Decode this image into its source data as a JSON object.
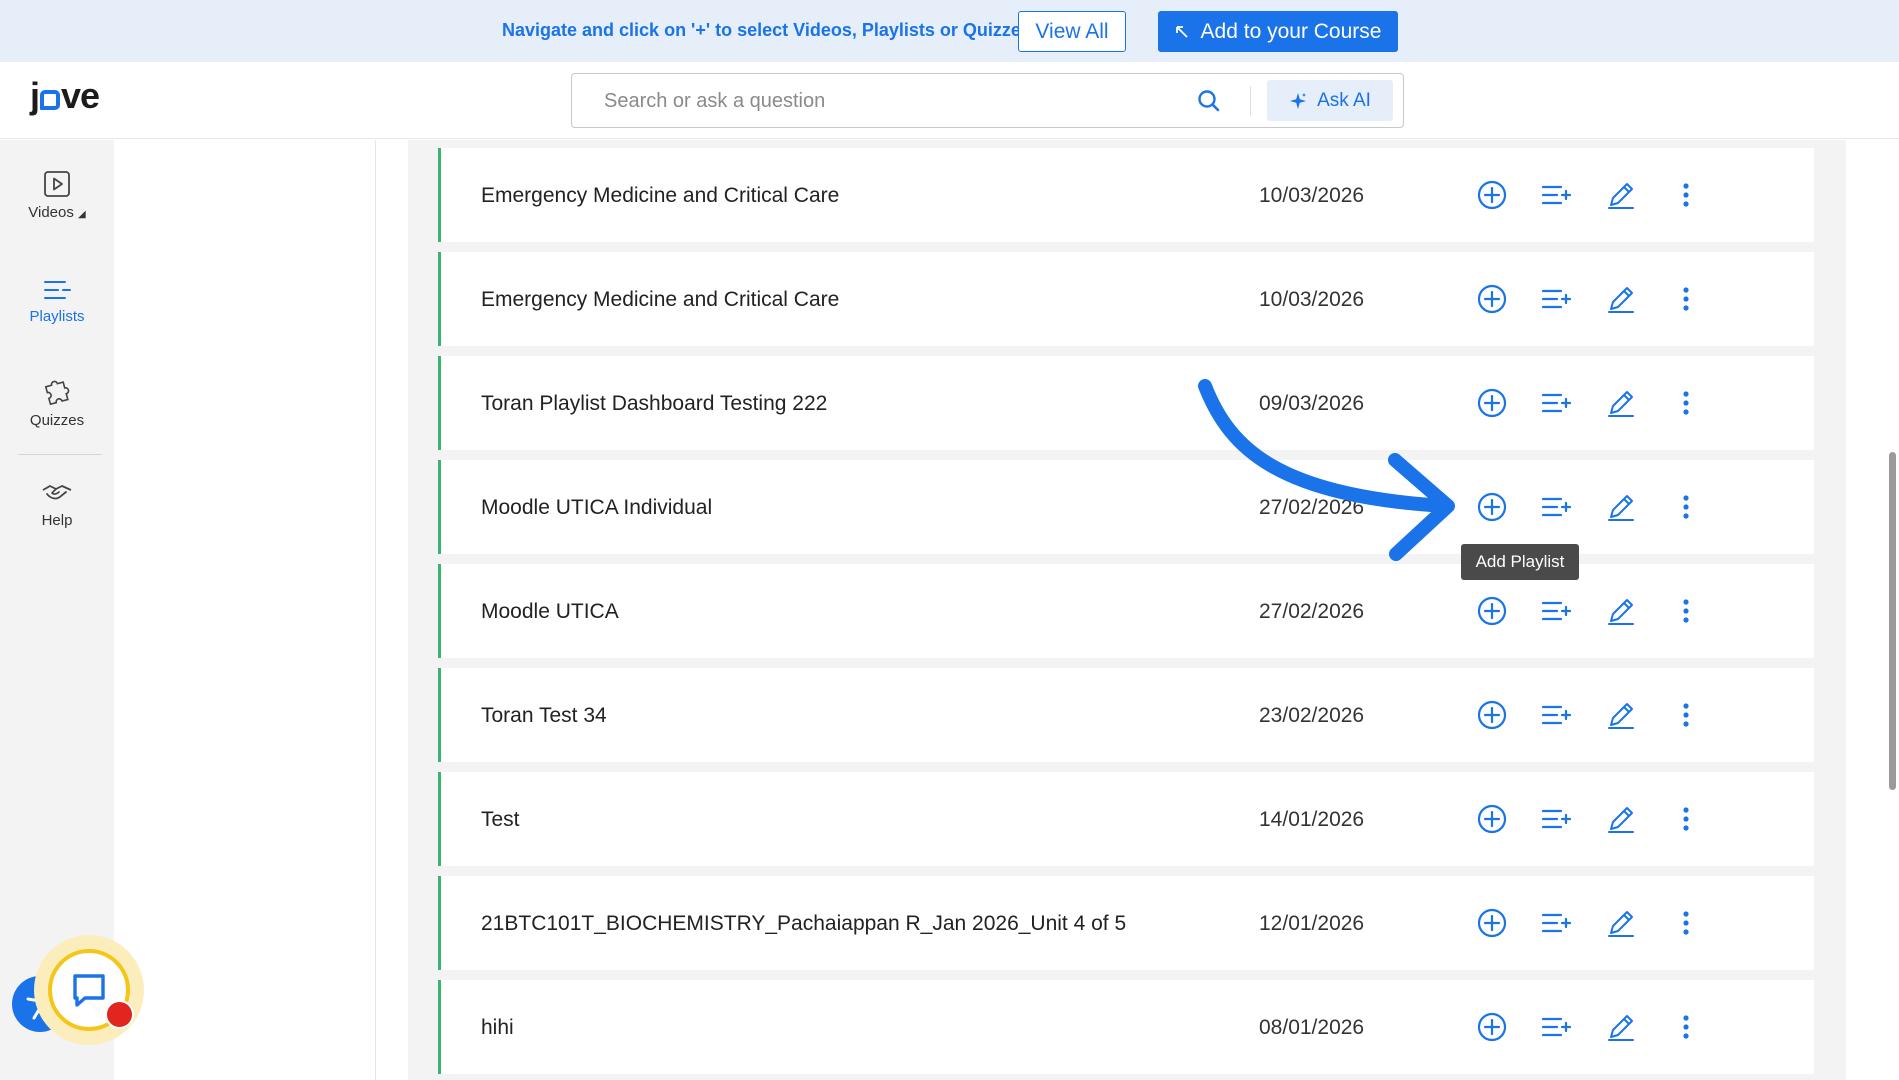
{
  "banner": {
    "text": "Navigate and click on '+' to select Videos, Playlists or Quizzes",
    "view_all_label": "View All",
    "add_course_label": "Add to your Course"
  },
  "header": {
    "logo_left": "j",
    "logo_right": "ve",
    "search_placeholder": "Search or ask a question",
    "ask_ai_label": "Ask AI"
  },
  "nav": {
    "videos": "Videos",
    "playlists": "Playlists",
    "quizzes": "Quizzes",
    "help": "Help"
  },
  "playlists": [
    {
      "title": "Emergency Medicine and Critical Care",
      "date": "10/03/2026"
    },
    {
      "title": "Emergency Medicine and Critical Care",
      "date": "10/03/2026"
    },
    {
      "title": "Toran Playlist Dashboard Testing 222",
      "date": "09/03/2026"
    },
    {
      "title": "Moodle UTICA Individual",
      "date": "27/02/2026"
    },
    {
      "title": "Moodle UTICA",
      "date": "27/02/2026"
    },
    {
      "title": "Toran Test 34",
      "date": "23/02/2026"
    },
    {
      "title": "Test",
      "date": "14/01/2026"
    },
    {
      "title": "21BTC101T_BIOCHEMISTRY_Pachaiappan R_Jan 2026_Unit 4 of 5",
      "date": "12/01/2026"
    },
    {
      "title": "hihi",
      "date": "08/01/2026"
    }
  ],
  "tooltip": "Add Playlist",
  "colors": {
    "accent": "#1a73e8",
    "row_border": "#3cb371",
    "banner_bg": "#e5eef9",
    "chat_notification": "#e0261f"
  },
  "icons": {
    "add": "plus-circle-icon",
    "add_to_list": "playlist-add-icon",
    "edit": "pencil-icon",
    "more": "more-vertical-icon"
  }
}
